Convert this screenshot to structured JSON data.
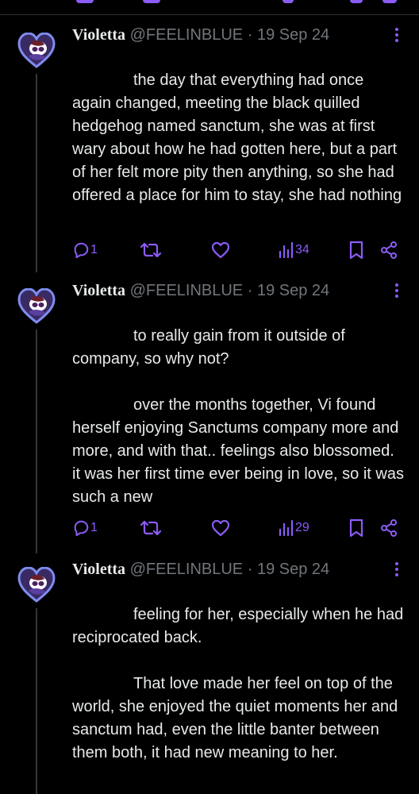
{
  "colors": {
    "background": "#000000",
    "text": "#e7e9ea",
    "secondary_text": "#71767b",
    "accent": "#8b5cf6",
    "divider": "#2f3336"
  },
  "tweets": [
    {
      "author_name": "Violetta",
      "handle": "@FEELINBLUE",
      "separator": "·",
      "date": "19 Sep 24",
      "avatar_icon": "heart-avatar-icon",
      "paragraphs": [
        "the day that everything had once again changed, meeting the black quilled hedgehog named sanctum, she was at first wary about how he had gotten here, but a part of her felt more pity then anything, so she had offered a place for him to stay, she had nothing"
      ],
      "reply_count": "1",
      "repost_count": "",
      "like_count": "",
      "view_count": "34"
    },
    {
      "author_name": "Violetta",
      "handle": "@FEELINBLUE",
      "separator": "·",
      "date": "19 Sep 24",
      "avatar_icon": "heart-avatar-icon",
      "paragraphs": [
        "to really gain from it outside of company, so why not?",
        "over the months together, Vi found herself enjoying Sanctums company more and more, and with that.. feelings also blossomed. it was her first time ever being in love, so it was such a new"
      ],
      "reply_count": "1",
      "repost_count": "",
      "like_count": "",
      "view_count": "29"
    },
    {
      "author_name": "Violetta",
      "handle": "@FEELINBLUE",
      "separator": "·",
      "date": "19 Sep 24",
      "avatar_icon": "heart-avatar-icon",
      "paragraphs": [
        "feeling for her, especially when he had reciprocated back.",
        "That love made her feel on top of the world, she enjoyed the quiet moments her and sanctum had, even the little banter between them both, it had new meaning to her."
      ]
    }
  ]
}
